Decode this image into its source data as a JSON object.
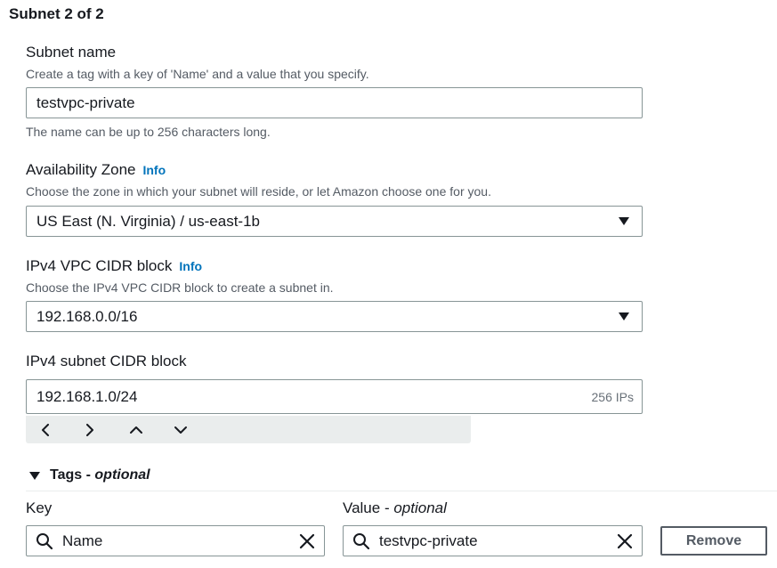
{
  "section": {
    "title": "Subnet 2 of 2"
  },
  "subnet_name": {
    "label": "Subnet name",
    "description": "Create a tag with a key of 'Name' and a value that you specify.",
    "value": "testvpc-private",
    "constraint": "The name can be up to 256 characters long."
  },
  "availability_zone": {
    "label": "Availability Zone",
    "info": "Info",
    "description": "Choose the zone in which your subnet will reside, or let Amazon choose one for you.",
    "selected": "US East (N. Virginia) / us-east-1b"
  },
  "vpc_cidr": {
    "label": "IPv4 VPC CIDR block",
    "info": "Info",
    "description": "Choose the IPv4 VPC CIDR block to create a subnet in.",
    "selected": "192.168.0.0/16"
  },
  "subnet_cidr": {
    "label": "IPv4 subnet CIDR block",
    "value": "192.168.1.0/24",
    "suffix": "256 IPs",
    "nav_icons": [
      "chevron-left-icon",
      "chevron-right-icon",
      "chevron-up-icon",
      "chevron-down-icon"
    ]
  },
  "tags": {
    "header": "Tags - ",
    "header_optional": "optional",
    "key_label": "Key",
    "value_label": "Value - ",
    "value_optional": "optional",
    "key_value": "Name",
    "value_value": "testvpc-private",
    "remove_label": "Remove"
  },
  "colors": {
    "link": "#0073bb",
    "text": "#16191f",
    "secondary_text": "#545b64",
    "border": "#879596",
    "hint_bar": "#eaeded"
  }
}
